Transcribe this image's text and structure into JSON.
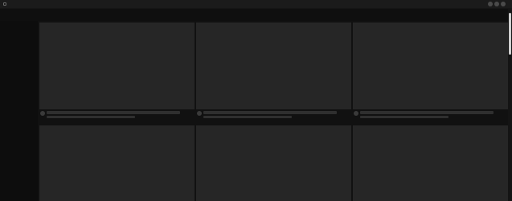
{
  "window": {
    "controls": [
      "minimize",
      "maximize",
      "close"
    ],
    "app_icon": "app-icon"
  },
  "grid": {
    "rows": 2,
    "columns": 3,
    "cards": [
      {
        "state": "loading-placeholder"
      },
      {
        "state": "loading-placeholder"
      },
      {
        "state": "loading-placeholder"
      },
      {
        "state": "loading-placeholder"
      },
      {
        "state": "loading-placeholder"
      },
      {
        "state": "loading-placeholder"
      }
    ]
  },
  "colors": {
    "background": "#0f0f0f",
    "placeholder": "#262626",
    "placeholder_line": "#2f2f2f",
    "scroll_thumb": "#cfcfcf"
  }
}
